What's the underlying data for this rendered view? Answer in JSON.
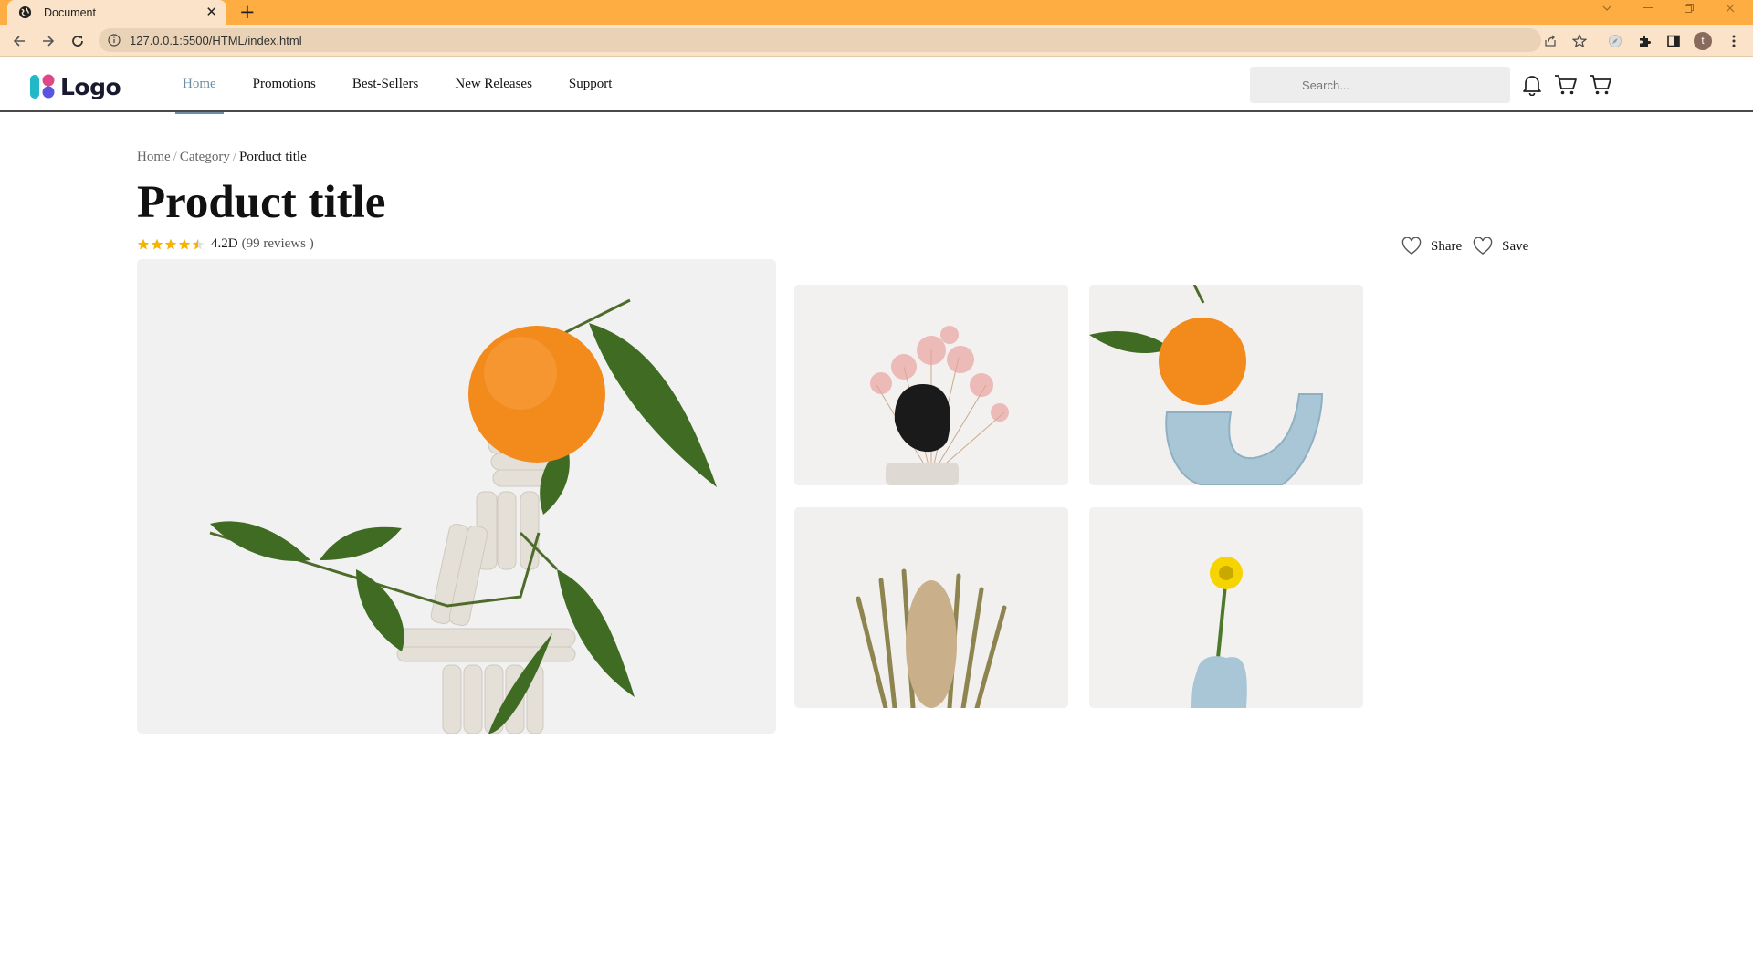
{
  "browser": {
    "tab_title": "Document",
    "tab_close": "✕",
    "new_tab": "+",
    "url": "127.0.0.1:5500/HTML/index.html",
    "profile_initial": "t"
  },
  "site": {
    "logo_text": "Logo",
    "nav": [
      {
        "label": "Home",
        "active": true
      },
      {
        "label": "Promotions",
        "active": false
      },
      {
        "label": "Best-Sellers",
        "active": false
      },
      {
        "label": "New Releases",
        "active": false
      },
      {
        "label": "Support",
        "active": false
      }
    ],
    "search_placeholder": "Search..."
  },
  "breadcrumb": {
    "items": [
      "Home",
      "Category"
    ],
    "separator": "/",
    "current": "Porduct title"
  },
  "product": {
    "title": "Product title",
    "rating_value": "4.2D",
    "rating_stars": 4.5,
    "reviews_text": "(99 reviews )",
    "share_label": "Share",
    "save_label": "Save"
  },
  "colors": {
    "tab_bar": "#fdad42",
    "toolbar": "#fbe3c9",
    "nav_active": "#6b8ea6",
    "star": "#f4b400"
  }
}
